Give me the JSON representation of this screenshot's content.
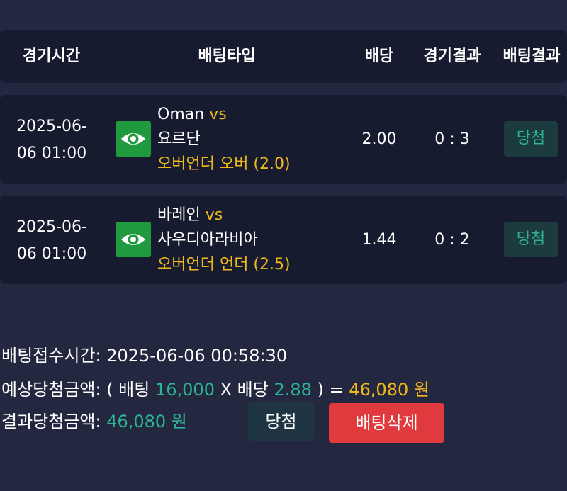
{
  "header": {
    "time": "경기시간",
    "type": "배팅타입",
    "odds": "배당",
    "game_result": "경기결과",
    "bet_result": "배팅결과"
  },
  "rows": [
    {
      "date": "2025-06-",
      "time": "06 01:00",
      "home": "Oman",
      "vs": "vs",
      "away": "요르단",
      "market": "오버언더 오버 (2.0)",
      "odds": "2.00",
      "score": "0 : 3",
      "result": "당첨",
      "icon": "eye-icon"
    },
    {
      "date": "2025-06-",
      "time": "06 01:00",
      "home": "바레인",
      "vs": "vs",
      "away": "사우디아라비아",
      "market": "오버언더 언더 (2.5)",
      "odds": "1.44",
      "score": "0 : 2",
      "result": "당첨",
      "icon": "eye-icon"
    }
  ],
  "summary": {
    "accept_label": "배팅접수시간: ",
    "accept_time": "2025-06-06 00:58:30",
    "expected_label": "예상당첨금액: ( 배팅 ",
    "stake": "16,000",
    "times": " X 배당 ",
    "total_odds": "2.88",
    "equals": " ) = ",
    "expected_amount": "46,080 원",
    "result_label": "결과당첨금액: ",
    "result_amount": "46,080 원"
  },
  "buttons": {
    "win": "당첨",
    "delete": "배팅삭제"
  },
  "colors": {
    "background": "#23273f",
    "panel": "#171b30",
    "gold": "#f1b81a",
    "teal": "#2bb596",
    "green_icon": "#1f9a3f",
    "delete_red": "#e03a3e"
  }
}
